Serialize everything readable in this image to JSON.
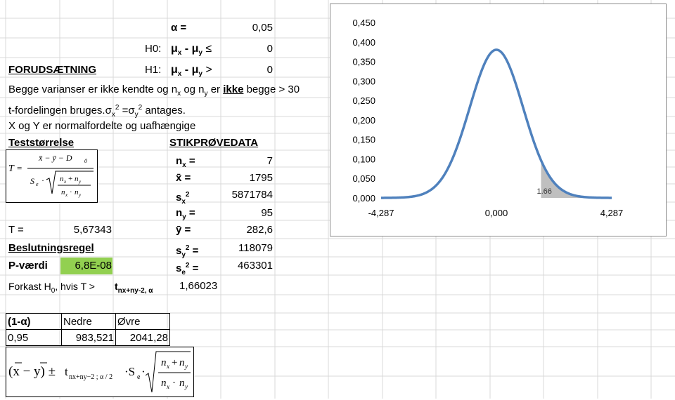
{
  "hyp": {
    "alpha_label": "α =",
    "alpha_value": "0,05",
    "h0_label": "H0:",
    "h0_expr": "μx - μy ≤",
    "h0_value": "0",
    "h1_label": "H1:",
    "h1_expr": "μx - μy >",
    "h1_value": "0"
  },
  "assumptions": {
    "heading": "FORUDSÆTNING",
    "line1_a": "Begge varianser er ikke kendte og n",
    "line1_sub1": "x",
    "line1_b": " og n",
    "line1_sub2": "y",
    "line1_c": " er ",
    "line1_bold": "ikke",
    "line1_d": " begge > 30",
    "line2_a": "t-fordelingen bruges.σ",
    "line2_sub1": "x",
    "line2_sup1": "2",
    "line2_b": " =σ",
    "line2_sub2": "y",
    "line2_sup2": "2",
    "line2_c": " antages.",
    "line3": "X og Y er normalfordelte og uafhængige"
  },
  "teststat": {
    "heading": "Teststørrelse",
    "T_label": "T  =",
    "T_value": "5,67343",
    "rule_heading": "Beslutningsregel",
    "p_label": "P-værdi",
    "p_value": "6,8E-08",
    "reject_a": "Forkast H",
    "reject_sub": "0",
    "reject_b": ", hvis T >",
    "reject_t": "t",
    "reject_tsub": "nx+ny-2, α",
    "reject_value": "1,66023"
  },
  "sample": {
    "heading": "STIKPRØVEDATA",
    "rows": [
      {
        "label": "n",
        "sub": "x",
        "sup": "",
        "suffix": " =",
        "value": "7"
      },
      {
        "label": "x̄",
        "sub": "",
        "sup": "",
        "suffix": "  =",
        "value": "1795"
      },
      {
        "label": "s",
        "sub": "x",
        "sup": "2",
        "suffix": "",
        "value": "5871784"
      },
      {
        "label": "n",
        "sub": "y",
        "sup": "",
        "suffix": " =",
        "value": "95"
      },
      {
        "label": "ȳ",
        "sub": "",
        "sup": "",
        "suffix": "  =",
        "value": "282,6"
      },
      {
        "label": "s",
        "sub": "y",
        "sup": "2",
        "suffix": " =",
        "value": "118079"
      },
      {
        "label": "s",
        "sub": "e",
        "sup": "2",
        "suffix": " =",
        "value": "463301"
      }
    ]
  },
  "ci": {
    "headers": [
      "(1-α)",
      "Nedre",
      "Øvre"
    ],
    "row": [
      "0,95",
      "983,521",
      "2041,28"
    ]
  },
  "chart_data": {
    "type": "area",
    "y_ticks": [
      "0,450",
      "0,400",
      "0,350",
      "0,300",
      "0,250",
      "0,200",
      "0,150",
      "0,100",
      "0,050",
      "0,000"
    ],
    "ylim": [
      0,
      0.45
    ],
    "x_ticks": [
      "-4,287",
      "0,000",
      "4,287"
    ],
    "xlim": [
      -4.287,
      4.287
    ],
    "series": [
      {
        "df": 100,
        "peak": 0.38
      }
    ],
    "critical_value": 1.66,
    "critical_label": "1.66",
    "line_color": "#4f81bd",
    "fill_color": "#bfbfbf"
  }
}
